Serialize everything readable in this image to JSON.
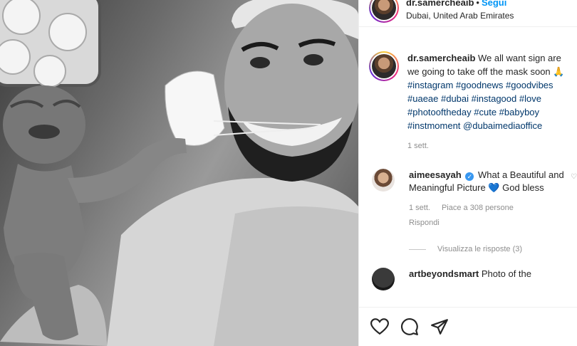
{
  "post": {
    "username": "dr.samercheaib",
    "follow_label": "Segui",
    "location": "Dubai, United Arab Emirates",
    "caption_text": "We all want sign are we going to take off the mask soon 🙏",
    "caption_tags": "#instagram #goodnews #goodvibes #uaeae #dubai #instagood #love #photooftheday #cute #babyboy #instmoment @dubaimediaoffice",
    "caption_time": "1 sett."
  },
  "comments": [
    {
      "username": "aimeesayah",
      "text": "What a Beautiful and Meaningful Picture",
      "emoji": "💙",
      "text_after": "God bless",
      "time": "1 sett.",
      "likes": "Piace a 308 persone",
      "reply": "Rispondi",
      "view_replies": "Visualizza le risposte (3)"
    },
    {
      "username": "artbeyondsmart",
      "text": "Photo of the"
    }
  ],
  "icons": {
    "like": "heart-icon",
    "comment": "comment-icon",
    "share": "share-icon"
  }
}
